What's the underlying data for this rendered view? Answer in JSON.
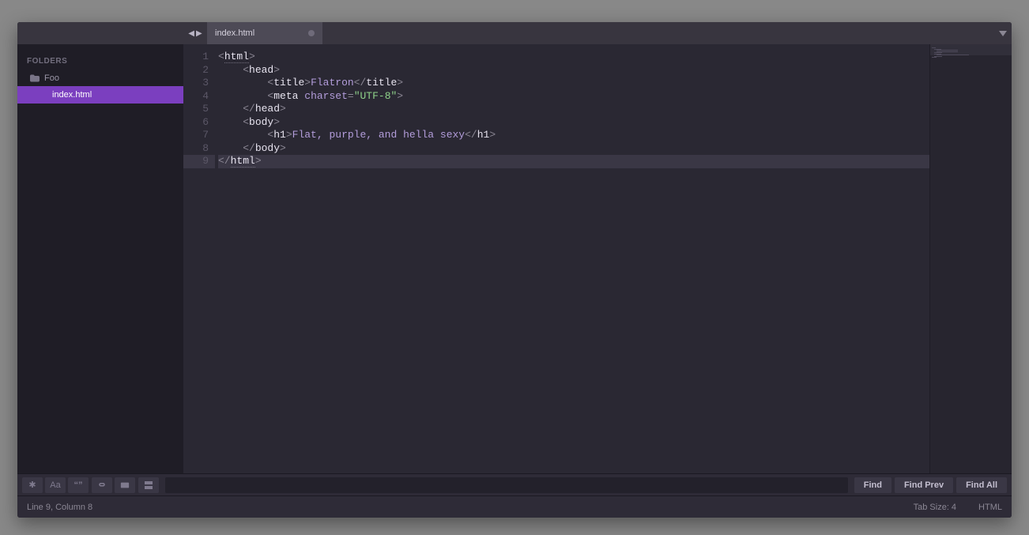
{
  "sidebar": {
    "title": "FOLDERS",
    "folder": "Foo",
    "files": [
      "index.html"
    ],
    "selected": "index.html"
  },
  "tabs": {
    "active": "index.html"
  },
  "editor": {
    "active_line": 9,
    "lines": [
      {
        "n": 1,
        "tokens": [
          [
            "pun",
            "<"
          ],
          [
            "tagname u",
            "html"
          ],
          [
            "pun",
            ">"
          ]
        ]
      },
      {
        "n": 2,
        "tokens": [
          [
            "ws",
            "    "
          ],
          [
            "pun",
            "<"
          ],
          [
            "tagname",
            "head"
          ],
          [
            "pun",
            ">"
          ]
        ]
      },
      {
        "n": 3,
        "tokens": [
          [
            "ws",
            "        "
          ],
          [
            "pun",
            "<"
          ],
          [
            "tagname",
            "title"
          ],
          [
            "pun",
            ">"
          ],
          [
            "txt",
            "Flatron"
          ],
          [
            "pun",
            "</"
          ],
          [
            "tagname",
            "title"
          ],
          [
            "pun",
            ">"
          ]
        ]
      },
      {
        "n": 4,
        "tokens": [
          [
            "ws",
            "        "
          ],
          [
            "pun",
            "<"
          ],
          [
            "tagname",
            "meta"
          ],
          [
            "ws",
            " "
          ],
          [
            "attr",
            "charset"
          ],
          [
            "pun",
            "="
          ],
          [
            "str",
            "\"UTF-8\""
          ],
          [
            "pun",
            ">"
          ]
        ]
      },
      {
        "n": 5,
        "tokens": [
          [
            "ws",
            "    "
          ],
          [
            "pun",
            "</"
          ],
          [
            "tagname",
            "head"
          ],
          [
            "pun",
            ">"
          ]
        ]
      },
      {
        "n": 6,
        "tokens": [
          [
            "ws",
            "    "
          ],
          [
            "pun",
            "<"
          ],
          [
            "tagname",
            "body"
          ],
          [
            "pun",
            ">"
          ]
        ]
      },
      {
        "n": 7,
        "tokens": [
          [
            "ws",
            "        "
          ],
          [
            "pun",
            "<"
          ],
          [
            "tagname",
            "h1"
          ],
          [
            "pun",
            ">"
          ],
          [
            "txt",
            "Flat, purple, and hella sexy"
          ],
          [
            "pun",
            "</"
          ],
          [
            "tagname",
            "h1"
          ],
          [
            "pun",
            ">"
          ]
        ]
      },
      {
        "n": 8,
        "tokens": [
          [
            "ws",
            "    "
          ],
          [
            "pun",
            "</"
          ],
          [
            "tagname",
            "body"
          ],
          [
            "pun",
            ">"
          ]
        ]
      },
      {
        "n": 9,
        "tokens": [
          [
            "pun",
            "</"
          ],
          [
            "tagname u",
            "html"
          ],
          [
            "pun",
            ">"
          ]
        ]
      }
    ]
  },
  "findbar": {
    "icons": [
      "regex",
      "case",
      "whole",
      "literal",
      "wrap",
      "selection"
    ],
    "actions": [
      "Find",
      "Find Prev",
      "Find All"
    ],
    "input_placeholder": ""
  },
  "status": {
    "left": "Line 9, Column 8",
    "tab_size": "Tab Size: 4",
    "syntax": "HTML"
  }
}
